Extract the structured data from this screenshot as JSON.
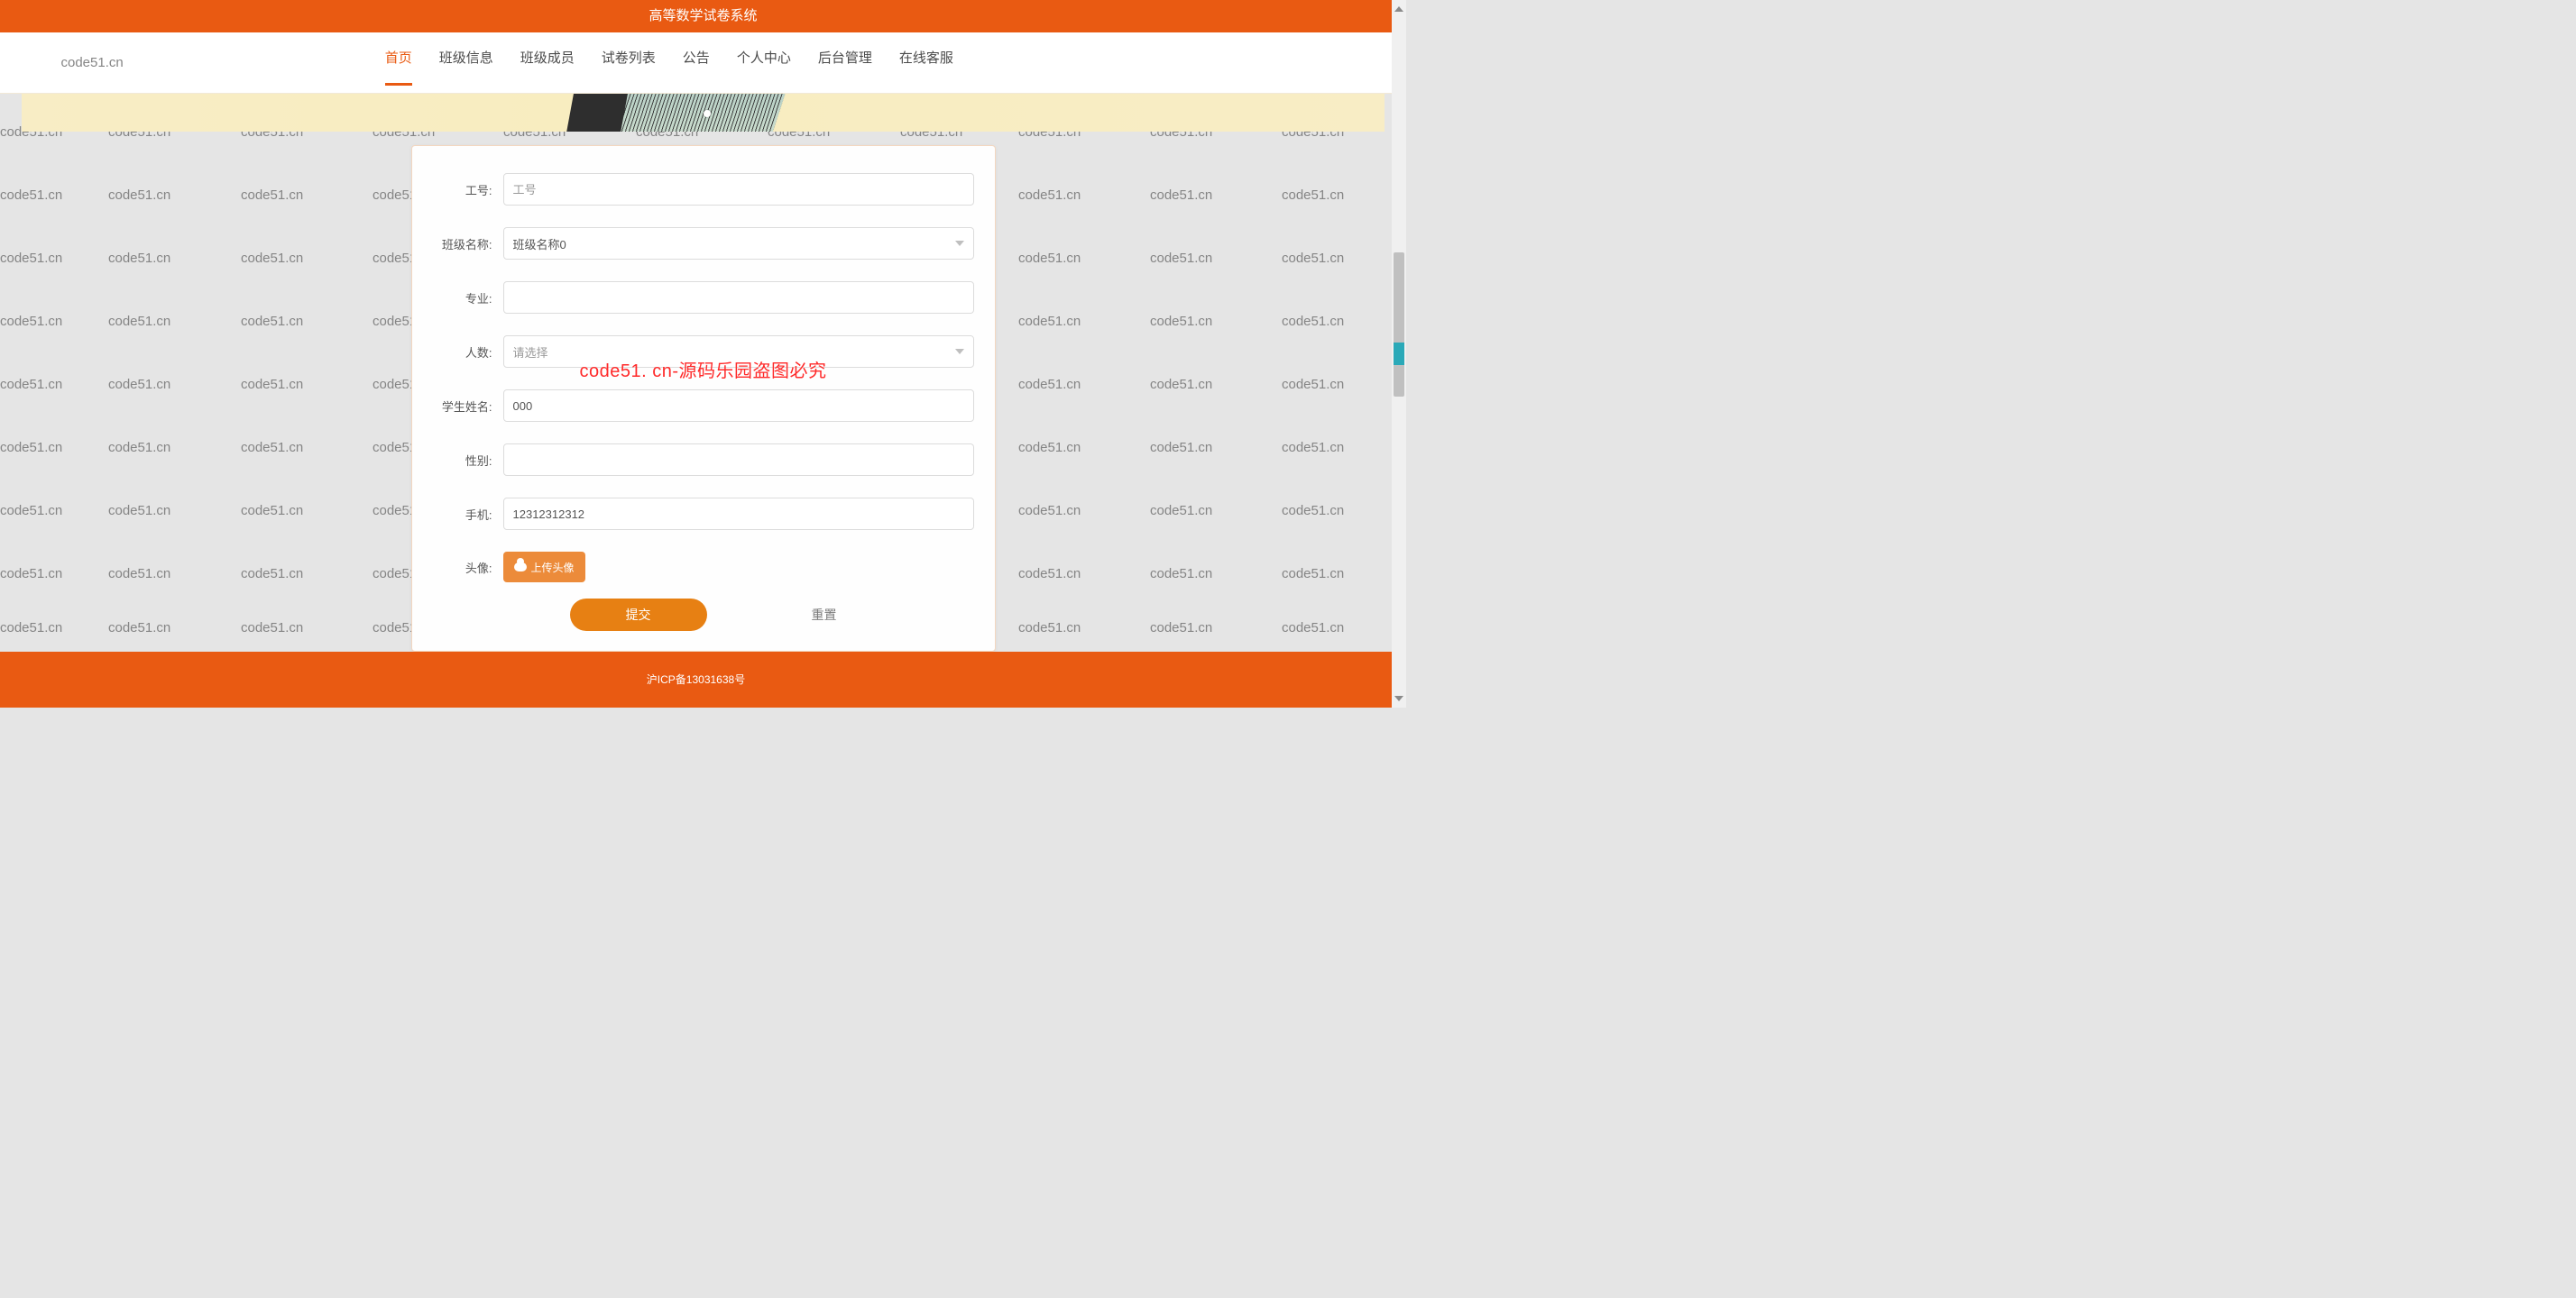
{
  "watermark_text": "code51.cn",
  "header": {
    "title": "高等数学试卷系统"
  },
  "nav": {
    "brand": "code51.cn",
    "items": [
      {
        "label": "首页",
        "active": true
      },
      {
        "label": "班级信息",
        "active": false
      },
      {
        "label": "班级成员",
        "active": false
      },
      {
        "label": "试卷列表",
        "active": false
      },
      {
        "label": "公告",
        "active": false
      },
      {
        "label": "个人中心",
        "active": false
      },
      {
        "label": "后台管理",
        "active": false
      },
      {
        "label": "在线客服",
        "active": false
      }
    ]
  },
  "form": {
    "job_no": {
      "label": "工号:",
      "placeholder": "工号",
      "value": ""
    },
    "class_name": {
      "label": "班级名称:",
      "selected": "班级名称0"
    },
    "major": {
      "label": "专业:",
      "value": ""
    },
    "count": {
      "label": "人数:",
      "selected": "请选择"
    },
    "student_name": {
      "label": "学生姓名:",
      "value": "000"
    },
    "gender": {
      "label": "性别:",
      "value": ""
    },
    "phone": {
      "label": "手机:",
      "value": "12312312312"
    },
    "avatar": {
      "label": "头像:",
      "upload_label": "上传头像"
    },
    "submit_label": "提交",
    "reset_label": "重置"
  },
  "center_watermark": "code51. cn-源码乐园盗图必究",
  "footer": {
    "icp": "沪ICP备13031638号"
  }
}
